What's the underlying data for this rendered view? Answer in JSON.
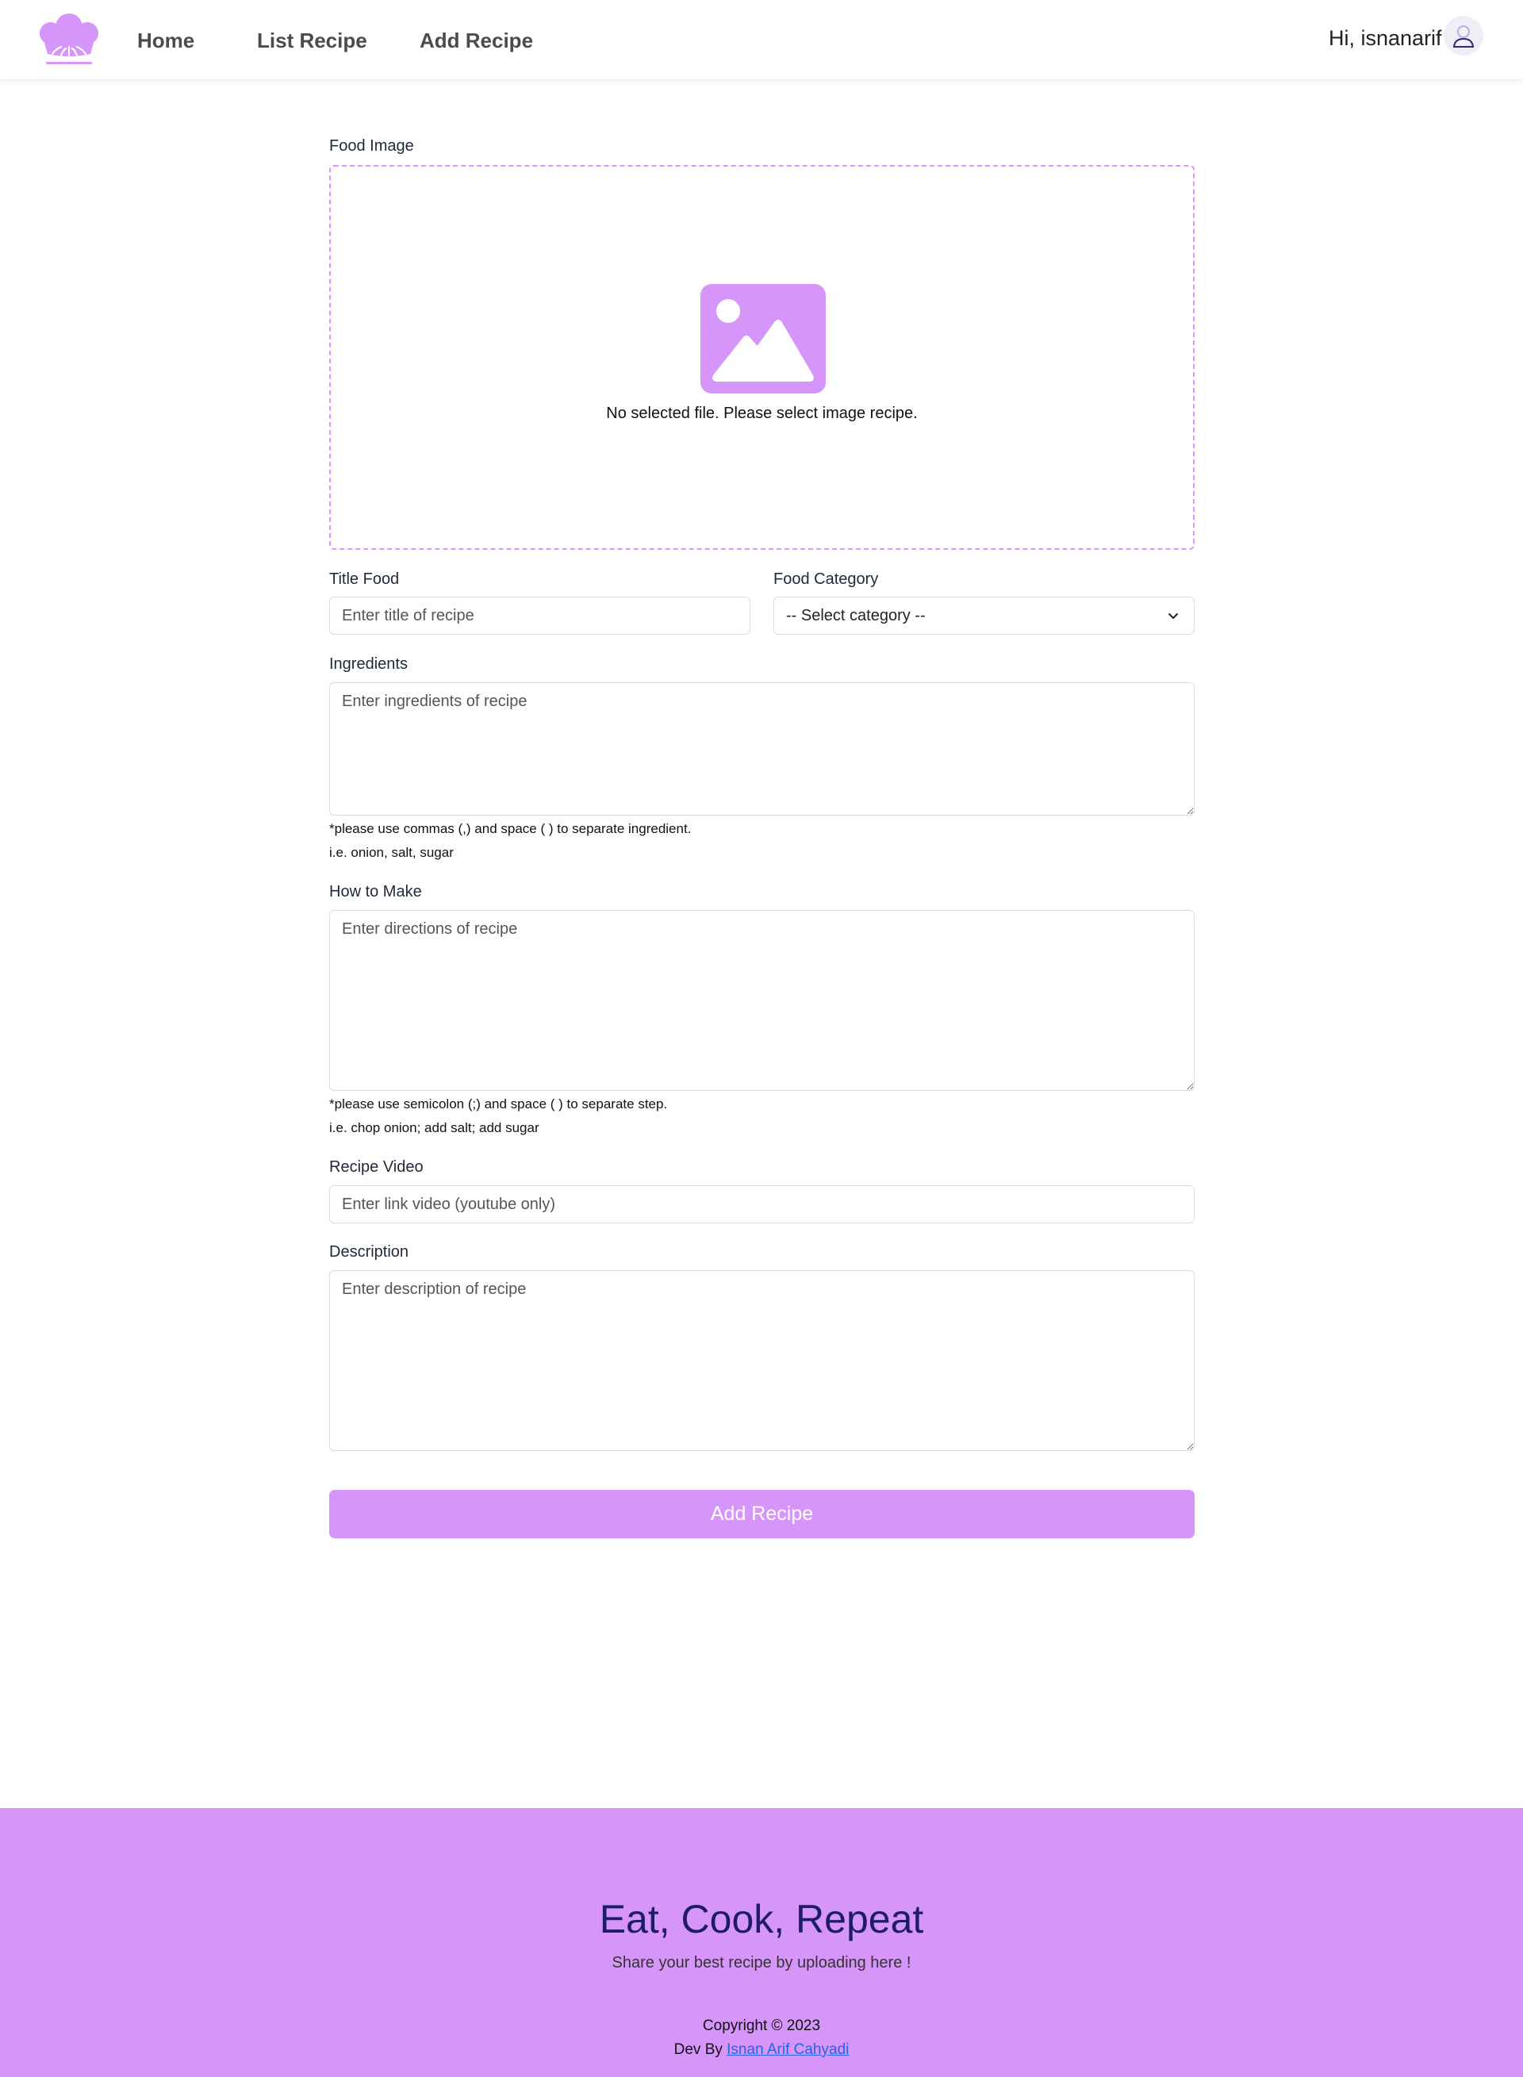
{
  "nav": {
    "logo": "chef-hat-logo",
    "links": [
      "Home",
      "List Recipe",
      "Add Recipe"
    ],
    "greeting": "Hi, isnanarif"
  },
  "form": {
    "food_image_label": "Food Image",
    "dropzone_text": "No selected file. Please select image recipe.",
    "title_label": "Title Food",
    "title_placeholder": "Enter title of recipe",
    "category_label": "Food Category",
    "category_selected": "-- Select category --",
    "ingredients_label": "Ingredients",
    "ingredients_placeholder": "Enter ingredients of recipe",
    "ingredients_hint_1": "*please use commas (,) and space ( ) to separate ingredient.",
    "ingredients_hint_2": "i.e. onion, salt, sugar",
    "howto_label": "How to Make",
    "howto_placeholder": "Enter directions of recipe",
    "howto_hint_1": "*please use semicolon (;) and space ( ) to separate step.",
    "howto_hint_2": "i.e. chop onion; add salt; add sugar",
    "video_label": "Recipe Video",
    "video_placeholder": "Enter link video (youtube only)",
    "description_label": "Description",
    "description_placeholder": "Enter description of recipe",
    "submit_label": "Add Recipe"
  },
  "footer": {
    "title": "Eat, Cook, Repeat",
    "subtitle": "Share your best recipe by uploading here !",
    "copyright": "Copyright © 2023",
    "dev_prefix": "Dev By",
    "dev_name": "Isnan Arif Cahyadi"
  },
  "colors": {
    "accent": "#d695f9",
    "footer_title": "#1e1b6e",
    "link": "#2563eb"
  }
}
